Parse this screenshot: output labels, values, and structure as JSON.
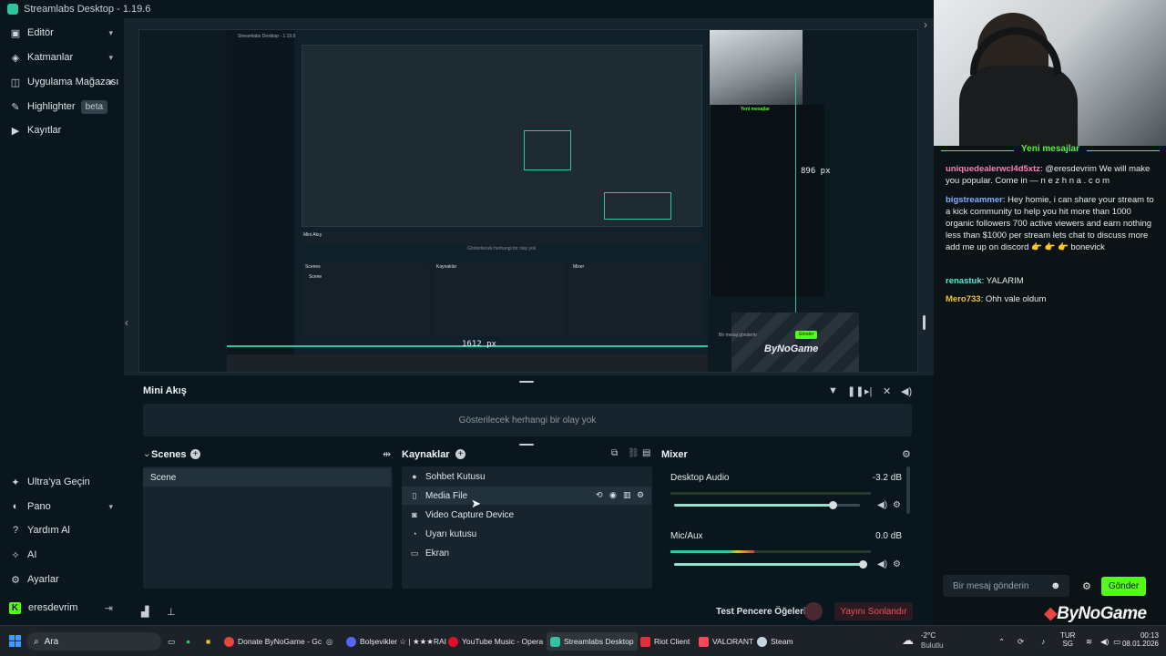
{
  "window": {
    "title": "Streamlabs Desktop - 1.19.6"
  },
  "sidebar": {
    "items": [
      {
        "label": "Editör",
        "icon": "window-icon",
        "chevron": true
      },
      {
        "label": "Katmanlar",
        "icon": "layers-icon",
        "chevron": true
      },
      {
        "label": "Uygulama Mağazası",
        "icon": "store-icon",
        "chevron": true
      },
      {
        "label": "Highlighter",
        "icon": "highlighter-icon",
        "badge": "beta"
      },
      {
        "label": "Kayıtlar",
        "icon": "play-circle-icon"
      }
    ],
    "bottom_items": [
      {
        "label": "Ultra'ya Geçin",
        "icon": "ultra-icon"
      },
      {
        "label": "Pano",
        "icon": "dashboard-icon",
        "chevron": true
      },
      {
        "label": "Yardım Al",
        "icon": "help-icon"
      },
      {
        "label": "AI",
        "icon": "sparkle-icon"
      },
      {
        "label": "Ayarlar",
        "icon": "gear-icon"
      }
    ],
    "user": {
      "name": "eresdevrim",
      "platform_icon": "kick-icon"
    }
  },
  "preview": {
    "label_width": "1612 px",
    "label_height": "896 px",
    "nested": {
      "title": "Streamlabs Desktop - 1.19.6",
      "mini_title": "Mini Akış",
      "empty_text": "Gösterilecek herhangi bir olay yok",
      "scenes_title": "Scenes",
      "scene_name": "Scene",
      "sources_title": "Kaynaklar",
      "mixer_title": "Mixer",
      "chat_header": "Yeni mesajlar",
      "brand": "ByNoGame",
      "send": "Gönder",
      "input_placeholder": "Bir mesaj gönderin"
    }
  },
  "mini_feed": {
    "title": "Mini Akış",
    "empty_text": "Gösterilecek herhangi bir olay yok"
  },
  "scenes": {
    "title": "Scenes",
    "items": [
      "Scene"
    ]
  },
  "sources": {
    "title": "Kaynaklar",
    "items": [
      {
        "label": "Sohbet Kutusu",
        "icon": "chat-bubble-icon"
      },
      {
        "label": "Media File",
        "icon": "file-icon",
        "selected": true
      },
      {
        "label": "Video Capture Device",
        "icon": "camera-icon"
      },
      {
        "label": "Uyarı kutusu",
        "icon": "bell-icon"
      },
      {
        "label": "Ekran",
        "icon": "monitor-icon"
      }
    ]
  },
  "mixer": {
    "title": "Mixer",
    "channels": [
      {
        "name": "Desktop Audio",
        "db": "-3.2 dB",
        "volume": 0.86,
        "level": 0.0
      },
      {
        "name": "Mic/Aux",
        "db": "0.0 dB",
        "volume": 1.0,
        "level": 0.42
      }
    ]
  },
  "footer": {
    "test_widgets": "Test Pencere Öğeleri",
    "end_stream": "Yayını Sonlandır"
  },
  "chat": {
    "header": "Yeni mesajlar",
    "messages": [
      {
        "user": "uniquedealerwcl4d5xtz",
        "color": "#ff7fb5",
        "text": "@eresdevrim We will make you popular. Come in — n e z h n a . c o m"
      },
      {
        "user": "bigstreammer",
        "color": "#7fb1ff",
        "text": "Hey homie, i can share your stream to a kick community to help you hit more than 1000 organic followers 700 active viewers and earn nothing less than $1000 per stream lets chat to discuss more add me up on discord 👉 👉 👉 bonevick"
      },
      {
        "user": "renastuk",
        "color": "#5fe3d0",
        "text": "YALARIM"
      },
      {
        "user": "Mero733",
        "color": "#f0c23a",
        "text": "Ohh vale oldum"
      }
    ],
    "input_placeholder": "Bir mesaj gönderin",
    "send_label": "Gönder",
    "brand": "ByNoGame"
  },
  "taskbar": {
    "search_placeholder": "Ara",
    "apps": [
      {
        "label": "Donate ByNoGame - Gc",
        "color": "#e8453c"
      },
      {
        "label": "Bolşevikler ☆ | ★★★RAI",
        "color": "#5865f2"
      },
      {
        "label": "YouTube Music - Opera",
        "color": "#e0102b"
      },
      {
        "label": "Streamlabs Desktop",
        "color": "#31c3a2",
        "active": true
      },
      {
        "label": "Riot Client",
        "color": "#e1303c"
      },
      {
        "label": "VALORANT",
        "color": "#ff4655"
      },
      {
        "label": "Steam",
        "color": "#c6d4df"
      }
    ],
    "weather": {
      "temp": "-2°C",
      "desc": "Bulutlu"
    },
    "lang": {
      "top": "TUR",
      "bottom": "SG"
    },
    "clock": {
      "time": "00:13",
      "date": "08.01.2026"
    }
  },
  "colors": {
    "accent": "#31c3a2",
    "kick_green": "#53fc18",
    "danger": "#f0525a",
    "bg": "#09161d",
    "panel": "#17242d"
  }
}
